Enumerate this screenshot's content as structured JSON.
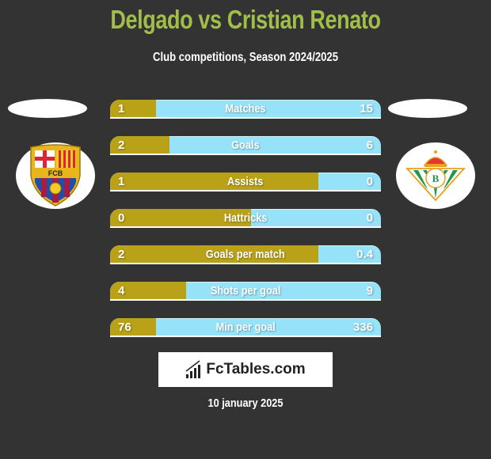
{
  "header": {
    "title": "Delgado vs Cristian Renato",
    "subtitle": "Club competitions, Season 2024/2025"
  },
  "teams": {
    "left": {
      "crest_icon": "fc-barcelona-crest-icon",
      "crest_text": "FCB"
    },
    "right": {
      "crest_icon": "real-betis-crest-icon"
    }
  },
  "colors": {
    "left_player": "#b9a218",
    "right_player": "#96e2f9",
    "title": "#a1bd4a",
    "background": "#333333"
  },
  "stats": [
    {
      "label": "Matches",
      "left": "1",
      "right": "15",
      "left_share": 0.17
    },
    {
      "label": "Goals",
      "left": "2",
      "right": "6",
      "left_share": 0.22
    },
    {
      "label": "Assists",
      "left": "1",
      "right": "0",
      "left_share": 0.77
    },
    {
      "label": "Hattricks",
      "left": "0",
      "right": "0",
      "left_share": 0.52
    },
    {
      "label": "Goals per match",
      "left": "2",
      "right": "0.4",
      "left_share": 0.77
    },
    {
      "label": "Shots per goal",
      "left": "4",
      "right": "9",
      "left_share": 0.28
    },
    {
      "label": "Min per goal",
      "left": "76",
      "right": "336",
      "left_share": 0.17
    }
  ],
  "footer": {
    "logo_text": "FcTables.com",
    "logo_icon": "bar-chart-icon",
    "date": "10 january 2025"
  }
}
